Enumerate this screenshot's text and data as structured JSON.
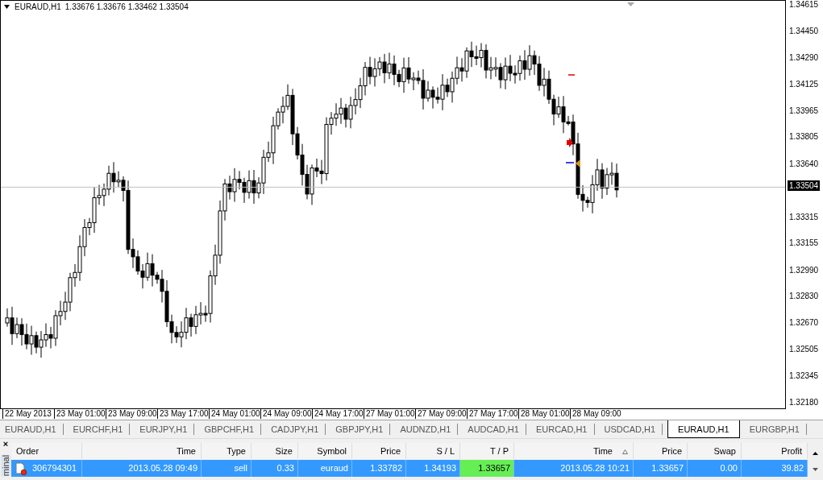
{
  "chart": {
    "symbol": "EURAUD,H1",
    "ohlc": "1.33676 1.33676 1.33462 1.33504",
    "price_ticks": [
      "1.34615",
      "1.34450",
      "1.34290",
      "1.34125",
      "1.33965",
      "1.33805",
      "1.33640",
      "1.33315",
      "1.33155",
      "1.32990",
      "1.32830",
      "1.32670",
      "1.32505",
      "1.32345",
      "1.32180"
    ],
    "current_price": "1.33504",
    "time_labels": [
      "22 May 2013",
      "23 May 01:00",
      "23 May 09:00",
      "23 May 17:00",
      "24 May 01:00",
      "24 May 09:00",
      "24 May 17:00",
      "27 May 01:00",
      "27 May 09:00",
      "27 May 17:00",
      "28 May 01:00",
      "28 May 09:00"
    ]
  },
  "tabs": [
    {
      "label": "EURAUD,H1",
      "selected": false
    },
    {
      "label": "EURCHF,H1",
      "selected": false
    },
    {
      "label": "EURJPY,H1",
      "selected": false
    },
    {
      "label": "GBPCHF,H1",
      "selected": false
    },
    {
      "label": "CADJPY,H1",
      "selected": false
    },
    {
      "label": "GBPJPY,H1",
      "selected": false
    },
    {
      "label": "AUDNZD,H1",
      "selected": false
    },
    {
      "label": "AUDCAD,H1",
      "selected": false
    },
    {
      "label": "EURCAD,H1",
      "selected": false
    },
    {
      "label": "USDCAD,H1",
      "selected": false
    },
    {
      "label": "EURAUD,H1",
      "selected": true
    },
    {
      "label": "EURGBP,H1",
      "selected": false
    }
  ],
  "terminal": {
    "close": "×",
    "side_label": "minal",
    "columns": [
      {
        "label": "Order",
        "sorted": false
      },
      {
        "label": "Time",
        "sorted": false
      },
      {
        "label": "Type",
        "sorted": false
      },
      {
        "label": "Size",
        "sorted": false
      },
      {
        "label": "Symbol",
        "sorted": false
      },
      {
        "label": "Price",
        "sorted": false
      },
      {
        "label": "S / L",
        "sorted": false
      },
      {
        "label": "T / P",
        "sorted": false
      },
      {
        "label": "Time",
        "sorted": true
      },
      {
        "label": "Price",
        "sorted": false
      },
      {
        "label": "Swap",
        "sorted": false
      },
      {
        "label": "Profit",
        "sorted": false
      }
    ],
    "rows": [
      {
        "selected": true,
        "tp_highlight": true,
        "cells": [
          "306794301",
          "2013.05.28 09:49",
          "sell",
          "0.33",
          "euraud",
          "1.33782",
          "1.34193",
          "1.33657",
          "2013.05.28 10:21",
          "1.33657",
          "0.00",
          "39.82"
        ]
      }
    ]
  }
}
